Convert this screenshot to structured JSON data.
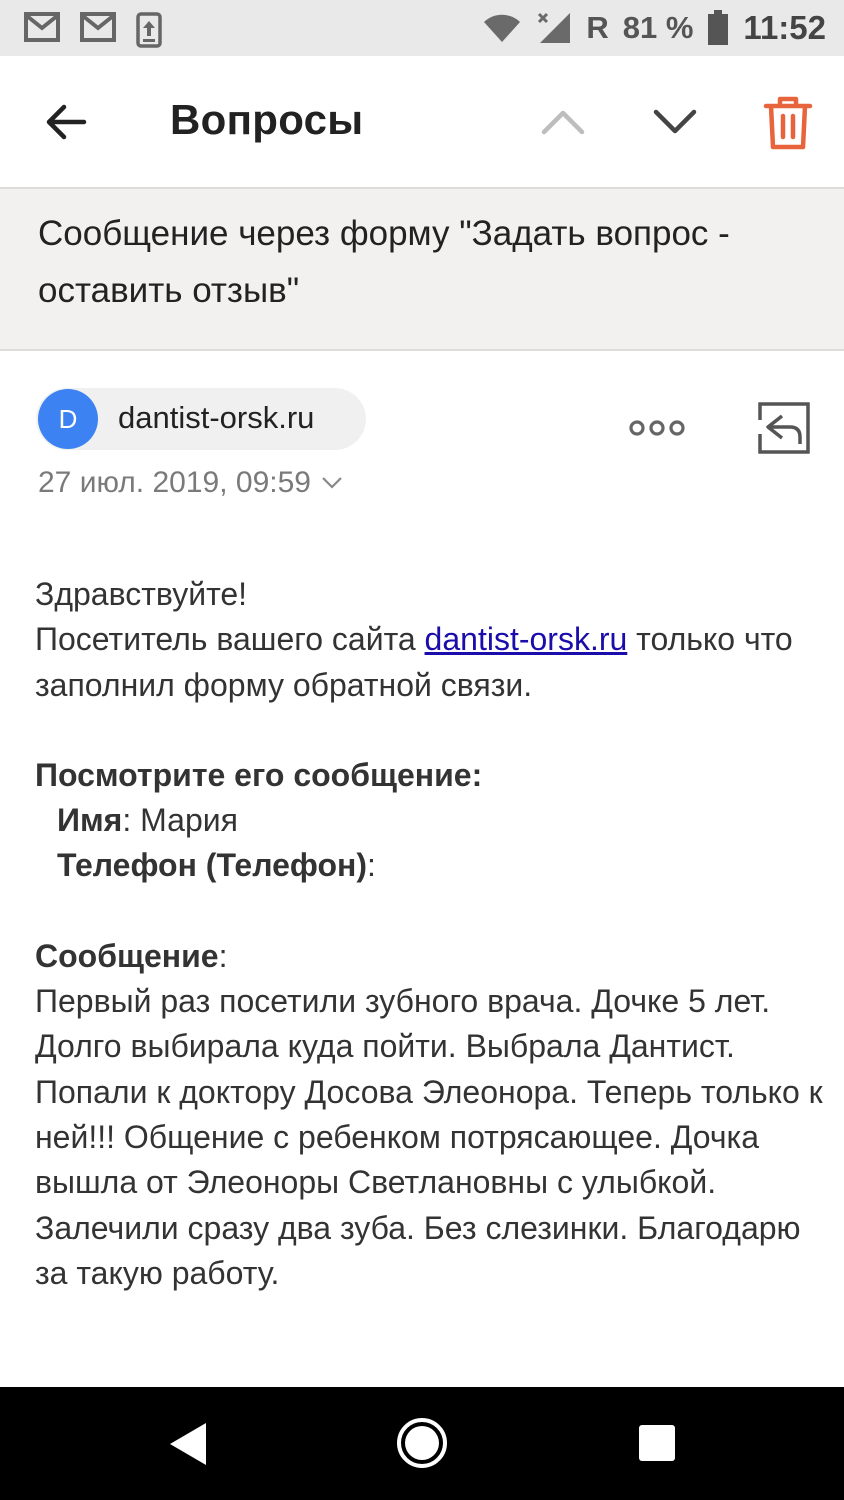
{
  "status_bar": {
    "battery_percent": "81 %",
    "time": "11:52",
    "roaming": "R",
    "icons": [
      "mail-icon",
      "mail-icon",
      "upload-icon",
      "wifi-icon",
      "signal-icon",
      "battery-icon"
    ]
  },
  "app_bar": {
    "title": "Вопросы",
    "icons": [
      "back-arrow-icon",
      "chevron-up-icon",
      "chevron-down-icon",
      "trash-icon"
    ],
    "trash_color": "#e8643c"
  },
  "message": {
    "subject": "Сообщение через форму \"Задать вопрос - оставить отзыв\"",
    "sender": {
      "avatar_letter": "D",
      "avatar_color": "#3d82f2",
      "name": "dantist-orsk.ru"
    },
    "date": "27 июл. 2019, 09:59",
    "body": {
      "greeting": "Здравствуйте!",
      "intro_before_link": "Посетитель вашего сайта ",
      "link_text": "dantist-orsk.ru",
      "intro_after_link": " только что заполнил форму обратной связи.",
      "section_title": "Посмотрите его сообщение:",
      "name_label": "Имя",
      "name_value": ": Мария",
      "phone_label": "Телефон (Телефон)",
      "phone_value": ":",
      "message_label": "Сообщение",
      "message_colon": ":",
      "message_text": "Первый раз посетили зубного врача. Дочке 5 лет. Долго выбирала куда пойти. Выбрала Дантист. Попали к доктору Досова Элеонора. Теперь только к ней!!! Общение с ребенком потрясающее. Дочка вышла от Элеоноры Светлановны с улыбкой. Залечили сразу два зуба. Без слезинки. Благодарю за такую работу."
    }
  },
  "nav_bar": {
    "icons": [
      "nav-back-icon",
      "nav-home-icon",
      "nav-recents-icon"
    ]
  }
}
